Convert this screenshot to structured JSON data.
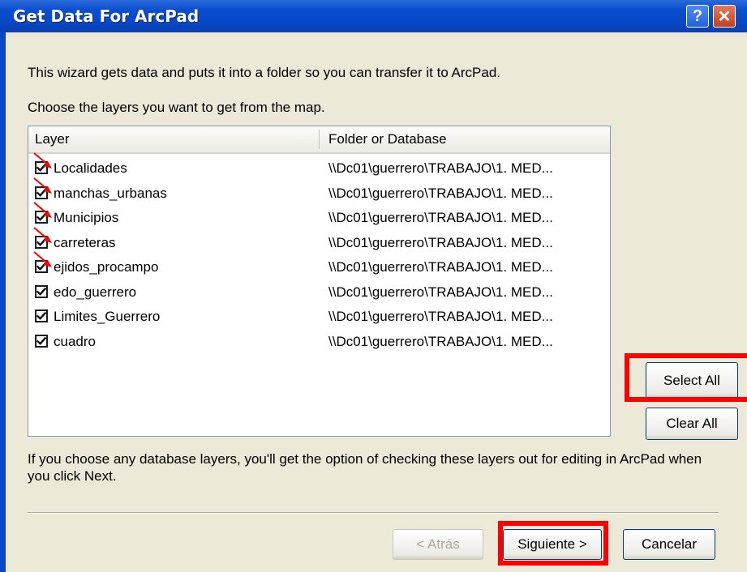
{
  "window": {
    "title": "Get Data For ArcPad",
    "help_label": "?",
    "close_label": "✕"
  },
  "intro_text": "This wizard gets data and puts it into a folder so you can transfer it to ArcPad.",
  "choose_text": "Choose the layers you want to get from the map.",
  "table": {
    "headers": {
      "layer": "Layer",
      "folder": "Folder or Database"
    },
    "rows": [
      {
        "layer": "Localidades",
        "folder": "\\\\Dc01\\guerrero\\TRABAJO\\1. MED...",
        "checked": true,
        "arrow": true
      },
      {
        "layer": "manchas_urbanas",
        "folder": "\\\\Dc01\\guerrero\\TRABAJO\\1. MED...",
        "checked": true,
        "arrow": true
      },
      {
        "layer": "Municipios",
        "folder": "\\\\Dc01\\guerrero\\TRABAJO\\1. MED...",
        "checked": true,
        "arrow": true
      },
      {
        "layer": "carreteras",
        "folder": "\\\\Dc01\\guerrero\\TRABAJO\\1. MED...",
        "checked": true,
        "arrow": true
      },
      {
        "layer": "ejidos_procampo",
        "folder": "\\\\Dc01\\guerrero\\TRABAJO\\1. MED...",
        "checked": true,
        "arrow": true
      },
      {
        "layer": "edo_guerrero",
        "folder": "\\\\Dc01\\guerrero\\TRABAJO\\1. MED...",
        "checked": true,
        "arrow": false
      },
      {
        "layer": "Limites_Guerrero",
        "folder": "\\\\Dc01\\guerrero\\TRABAJO\\1. MED...",
        "checked": true,
        "arrow": false
      },
      {
        "layer": "cuadro",
        "folder": "\\\\Dc01\\guerrero\\TRABAJO\\1. MED...",
        "checked": true,
        "arrow": false
      }
    ]
  },
  "buttons": {
    "select_all": "Select All",
    "clear_all": "Clear All",
    "back": "< Atrás",
    "next": "Siguiente >",
    "cancel": "Cancelar"
  },
  "note_text": "If you choose any database layers, you'll get the option of checking these layers out for editing in ArcPad when you click Next.",
  "colors": {
    "titlebar": "#0847c6",
    "dialog_bg": "#ece9d8",
    "highlight": "#ff0000"
  }
}
